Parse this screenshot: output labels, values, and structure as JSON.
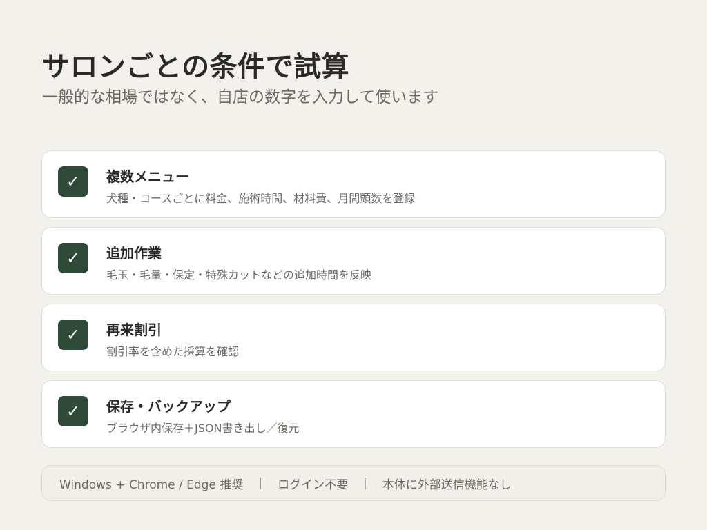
{
  "header": {
    "title": "サロンごとの条件で試算",
    "subtitle": "一般的な相場ではなく、自店の数字を入力して使います"
  },
  "features": [
    {
      "check": "✓",
      "title": "複数メニュー",
      "description": "犬種・コースごとに料金、施術時間、材料費、月間頭数を登録"
    },
    {
      "check": "✓",
      "title": "追加作業",
      "description": "毛玉・毛量・保定・特殊カットなどの追加時間を反映"
    },
    {
      "check": "✓",
      "title": "再来割引",
      "description": "割引率を含めた採算を確認"
    },
    {
      "check": "✓",
      "title": "保存・バックアップ",
      "description": "ブラウザ内保存＋JSON書き出し／復元"
    }
  ],
  "footer": {
    "items": [
      "Windows + Chrome / Edge 推奨",
      "ログイン不要",
      "本体に外部送信機能なし"
    ],
    "separator": "|"
  },
  "colors": {
    "background": "#f3f1ec",
    "card": "#ffffff",
    "check_accent": "#2f4a38",
    "text": "#2a2a27",
    "muted_text": "#6c6a64"
  }
}
